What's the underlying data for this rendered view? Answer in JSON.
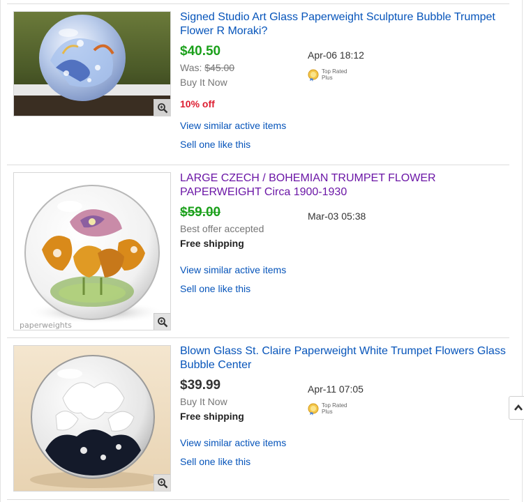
{
  "listings": [
    {
      "title": "Signed Studio Art Glass Paperweight Sculpture Bubble Trumpet Flower R Moraki?",
      "price": "$40.50",
      "was_label": "Was:",
      "was_price": "$45.00",
      "format": "Buy It Now",
      "discount": "10% off",
      "end_time": "Apr-06 18:12",
      "badge": "Top Rated\nPlus",
      "view_similar": "View similar active items",
      "sell_one": "Sell one like this"
    },
    {
      "title": "LARGE CZECH / BOHEMIAN TRUMPET FLOWER PAPERWEIGHT Circa 1900-1930",
      "price": "$59.00",
      "status": "Best offer accepted",
      "shipping": "Free shipping",
      "end_time": "Mar-03 05:38",
      "watermark": "paperweights",
      "view_similar": "View similar active items",
      "sell_one": "Sell one like this"
    },
    {
      "title": "Blown Glass St. Claire Paperweight White Trumpet Flowers Glass Bubble Center",
      "price": "$39.99",
      "format": "Buy It Now",
      "shipping": "Free shipping",
      "end_time": "Apr-11 07:05",
      "badge": "Top Rated\nPlus",
      "view_similar": "View similar active items",
      "sell_one": "Sell one like this"
    }
  ],
  "icons": {
    "zoom": "magnifier-icon",
    "badge": "top-rated-seal-icon",
    "scroll_top": "chevron-up-icon"
  },
  "colors": {
    "link": "#0654ba",
    "visited_link": "#6b16a6",
    "sale_price": "#1ba01b",
    "discount": "#dd1e31"
  }
}
